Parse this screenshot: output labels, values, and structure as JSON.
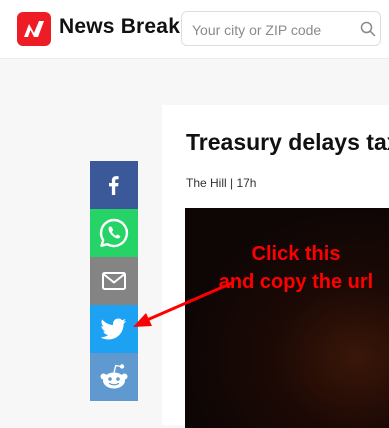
{
  "header": {
    "brand_name": "News Break",
    "search": {
      "placeholder": "Your city or ZIP code",
      "value": ""
    }
  },
  "share_bar": {
    "items": [
      {
        "network": "facebook",
        "icon": "facebook-icon",
        "color": "#3b5998"
      },
      {
        "network": "whatsapp",
        "icon": "whatsapp-icon",
        "color": "#25d366"
      },
      {
        "network": "email",
        "icon": "mail-icon",
        "color": "#848484"
      },
      {
        "network": "twitter",
        "icon": "twitter-icon",
        "color": "#1da1f2"
      },
      {
        "network": "reddit",
        "icon": "reddit-icon",
        "color": "#5f99cf"
      }
    ]
  },
  "article": {
    "title": "Treasury delays tax",
    "meta": "The Hill | 17h"
  },
  "annotation": {
    "line1": "Click this",
    "line2": "and copy the url",
    "color": "#ff0000"
  },
  "colors": {
    "brand": "#ee1c25",
    "page_background": "#f7f7f7"
  }
}
